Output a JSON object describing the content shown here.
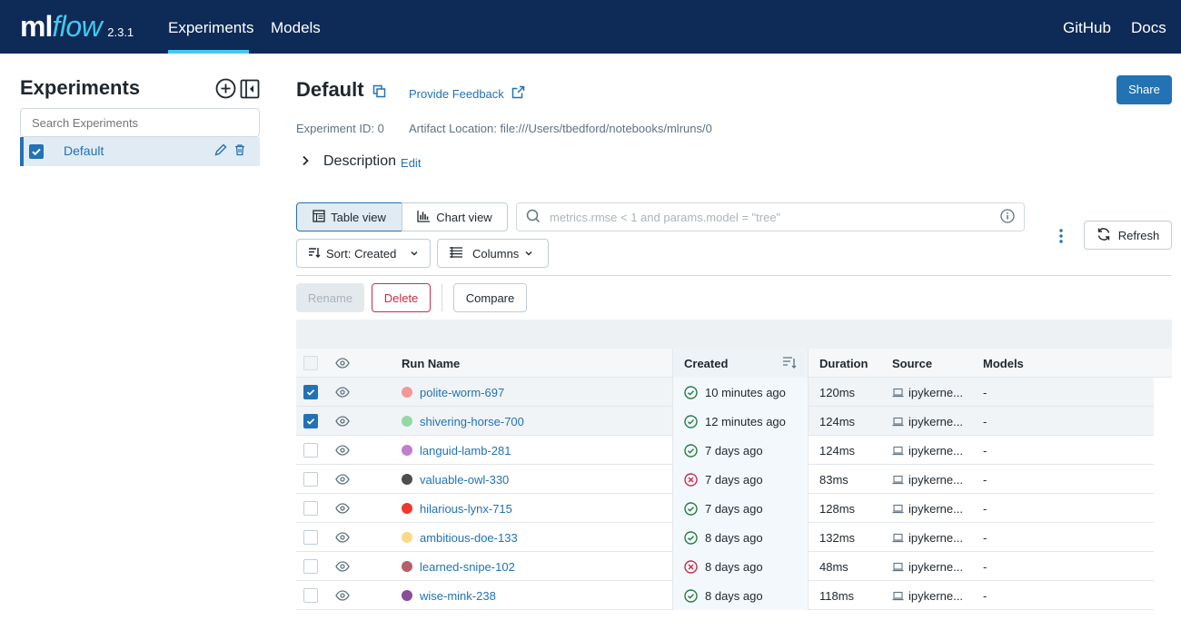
{
  "header": {
    "logo_ml": "ml",
    "logo_flow": "flow",
    "version": "2.3.1",
    "tabs": [
      {
        "label": "Experiments"
      },
      {
        "label": "Models"
      }
    ],
    "links": [
      {
        "label": "GitHub"
      },
      {
        "label": "Docs"
      }
    ],
    "brand_color": "#0e2a57",
    "accent_color": "#43c9ed"
  },
  "sidebar": {
    "title": "Experiments",
    "search_placeholder": "Search Experiments",
    "items": [
      {
        "label": "Default",
        "checked": true
      }
    ]
  },
  "main": {
    "title": "Default",
    "feedback_label": "Provide Feedback",
    "share_label": "Share",
    "experiment_id": "Experiment ID: 0",
    "artifact_location": "Artifact Location: file:///Users/tbedford/notebooks/mlruns/0",
    "description_label": "Description",
    "edit_label": "Edit",
    "toolbar": {
      "table_view": "Table view",
      "chart_view": "Chart view",
      "search_placeholder": "metrics.rmse < 1 and params.model = \"tree\"",
      "refresh": "Refresh",
      "sort": "Sort: Created",
      "columns": "Columns",
      "rename": "Rename",
      "delete": "Delete",
      "compare": "Compare"
    },
    "table": {
      "columns": [
        "Run Name",
        "Created",
        "Duration",
        "Source",
        "Models"
      ],
      "rows": [
        {
          "name": "polite-worm-697",
          "color": "#f19999",
          "status": "success",
          "created": "10 minutes ago",
          "duration": "120ms",
          "source": "ipykerne...",
          "models": "-",
          "checked": true
        },
        {
          "name": "shivering-horse-700",
          "color": "#94d8a6",
          "status": "success",
          "created": "12 minutes ago",
          "duration": "124ms",
          "source": "ipykerne...",
          "models": "-",
          "checked": true
        },
        {
          "name": "languid-lamb-281",
          "color": "#c27ecb",
          "status": "success",
          "created": "7 days ago",
          "duration": "124ms",
          "source": "ipykerne...",
          "models": "-",
          "checked": false
        },
        {
          "name": "valuable-owl-330",
          "color": "#4e4e4e",
          "status": "failed",
          "created": "7 days ago",
          "duration": "83ms",
          "source": "ipykerne...",
          "models": "-",
          "checked": false
        },
        {
          "name": "hilarious-lynx-715",
          "color": "#f0372d",
          "status": "success",
          "created": "7 days ago",
          "duration": "128ms",
          "source": "ipykerne...",
          "models": "-",
          "checked": false
        },
        {
          "name": "ambitious-doe-133",
          "color": "#fad98a",
          "status": "success",
          "created": "8 days ago",
          "duration": "132ms",
          "source": "ipykerne...",
          "models": "-",
          "checked": false
        },
        {
          "name": "learned-snipe-102",
          "color": "#b45f69",
          "status": "failed",
          "created": "8 days ago",
          "duration": "48ms",
          "source": "ipykerne...",
          "models": "-",
          "checked": false
        },
        {
          "name": "wise-mink-238",
          "color": "#8b4a9a",
          "status": "success",
          "created": "8 days ago",
          "duration": "118ms",
          "source": "ipykerne...",
          "models": "-",
          "checked": false
        }
      ]
    }
  }
}
